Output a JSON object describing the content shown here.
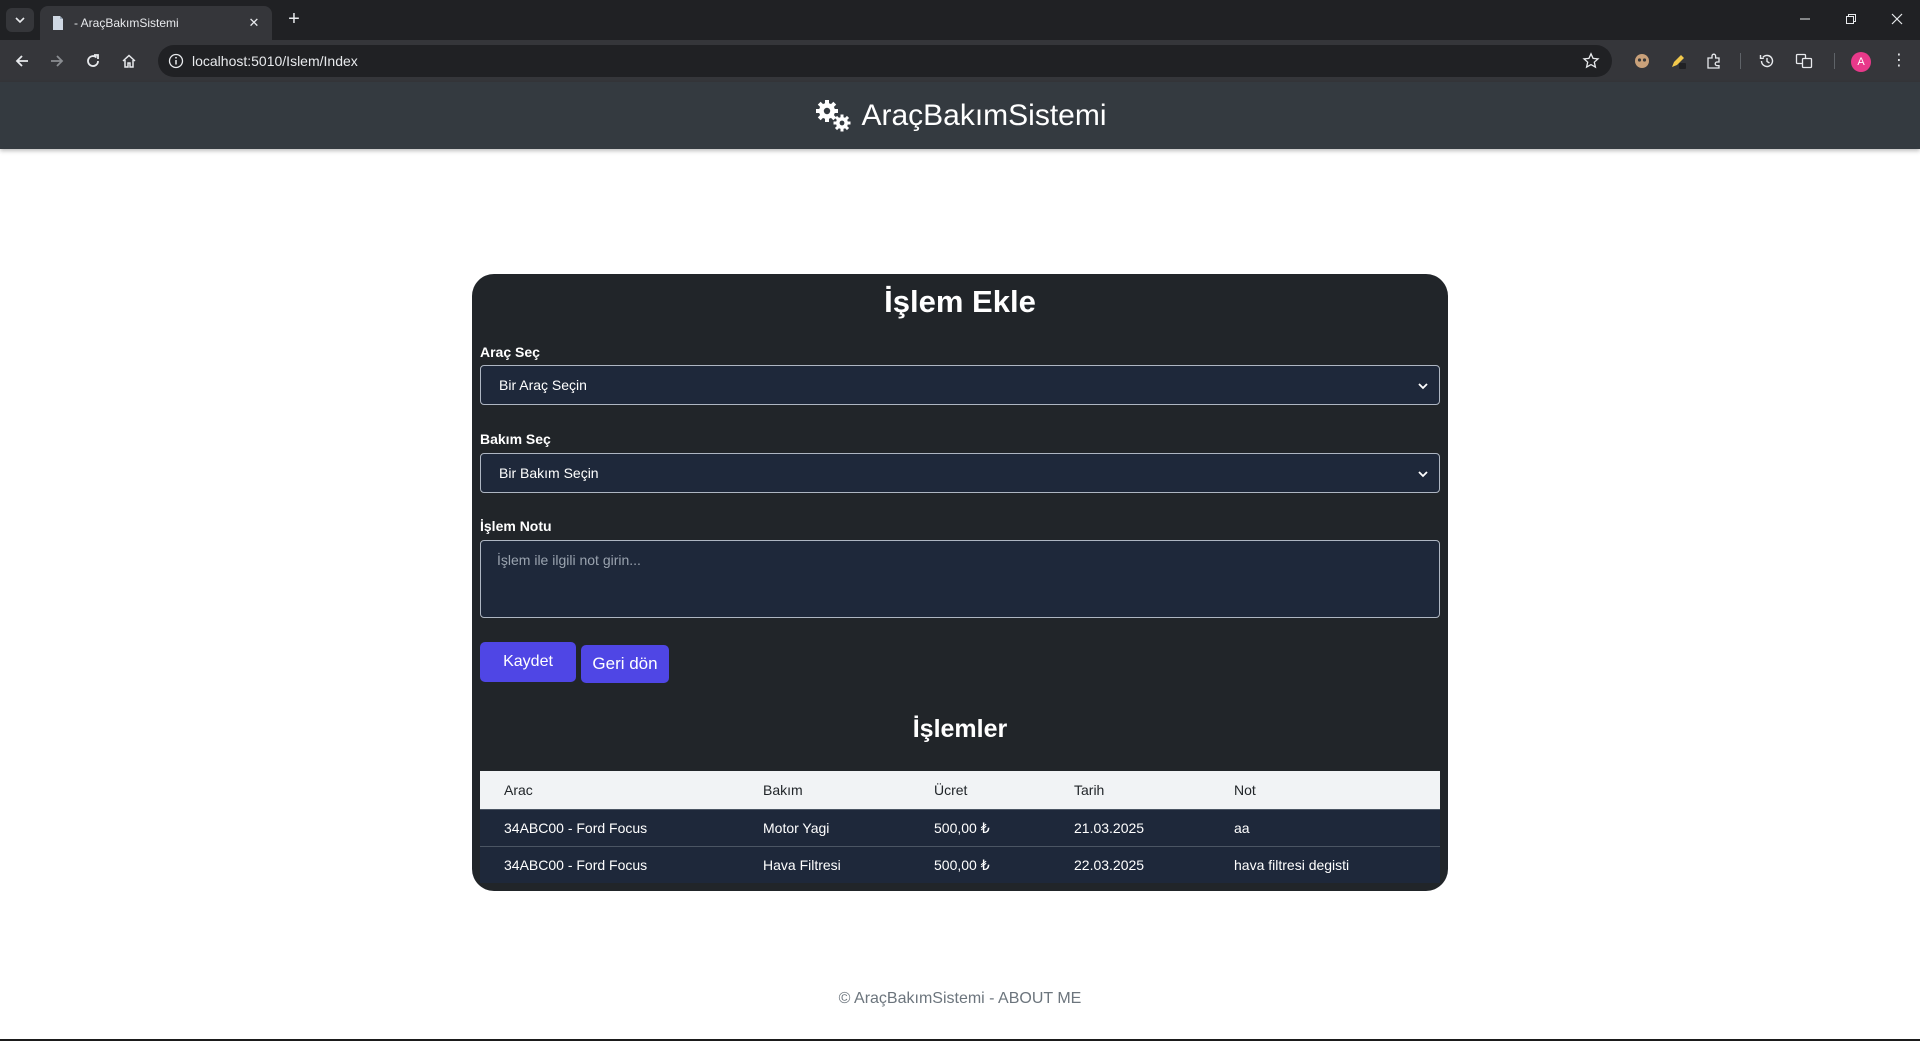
{
  "browser": {
    "tab_title": "- AraçBakımSistemi",
    "new_tab": "+",
    "close_tab": "✕",
    "url": "localhost:5010/Islem/Index",
    "avatar_initial": "A",
    "menu": "⋮"
  },
  "header": {
    "brand": "AraçBakımSistemi",
    "icon": "gears-icon"
  },
  "form": {
    "title": "İşlem Ekle",
    "arac_label": "Araç Seç",
    "arac_selected": "Bir Araç Seçin",
    "bakim_label": "Bakım Seç",
    "bakim_selected": "Bir Bakım Seçin",
    "not_label": "İşlem Notu",
    "not_placeholder": "İşlem ile ilgili not girin...",
    "save_label": "Kaydet",
    "back_label": "Geri dön"
  },
  "list": {
    "title": "İşlemler",
    "columns": [
      "Arac",
      "Bakım",
      "Ücret",
      "Tarih",
      "Not"
    ],
    "rows": [
      [
        "34ABC00 - Ford Focus",
        "Motor Yagi",
        "500,00 ₺",
        "21.03.2025",
        "aa"
      ],
      [
        "34ABC00 - Ford Focus",
        "Hava Filtresi",
        "500,00 ₺",
        "22.03.2025",
        "hava filtresi degisti"
      ]
    ]
  },
  "footer": {
    "text": "© AraçBakımSistemi - ABOUT ME"
  },
  "colors": {
    "accent": "#4f46e5",
    "card": "#212529",
    "navbar": "#343a40",
    "input": "#1e283a"
  }
}
